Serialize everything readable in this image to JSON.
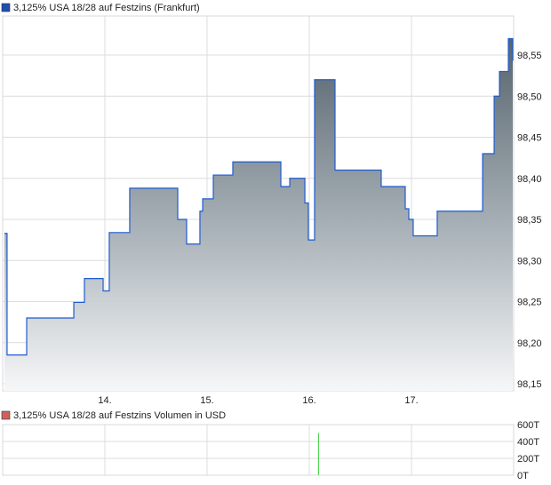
{
  "chart_data": [
    {
      "type": "area",
      "title": "3,125% USA 18/28 auf Festzins (Frankfurt)",
      "legend_color": "#1f4fb0",
      "line_color": "#1f5bd0",
      "x_ticks": [
        {
          "day": 14,
          "label": "14."
        },
        {
          "day": 15,
          "label": "15."
        },
        {
          "day": 16,
          "label": "16."
        },
        {
          "day": 17,
          "label": "17."
        }
      ],
      "xlim": [
        13.0,
        18.0
      ],
      "ylim": [
        98.13,
        98.597
      ],
      "y_ticks": [
        {
          "v": 98.15,
          "label": "98,15"
        },
        {
          "v": 98.2,
          "label": "98,20"
        },
        {
          "v": 98.25,
          "label": "98,25"
        },
        {
          "v": 98.3,
          "label": "98,30"
        },
        {
          "v": 98.35,
          "label": "98,35"
        },
        {
          "v": 98.4,
          "label": "98,40"
        },
        {
          "v": 98.45,
          "label": "98,45"
        },
        {
          "v": 98.5,
          "label": "98,50"
        },
        {
          "v": 98.55,
          "label": "98,55"
        }
      ],
      "points": [
        [
          13.017,
          98.333
        ],
        [
          13.043,
          98.185
        ],
        [
          13.235,
          98.23
        ],
        [
          13.696,
          98.249
        ],
        [
          13.8,
          98.278
        ],
        [
          13.983,
          98.263
        ],
        [
          14.043,
          98.334
        ],
        [
          14.243,
          98.388
        ],
        [
          14.713,
          98.35
        ],
        [
          14.8,
          98.32
        ],
        [
          14.93,
          98.36
        ],
        [
          14.957,
          98.375
        ],
        [
          15.061,
          98.404
        ],
        [
          15.252,
          98.42
        ],
        [
          15.722,
          98.39
        ],
        [
          15.809,
          98.4
        ],
        [
          15.939,
          98.4
        ],
        [
          15.957,
          98.37
        ],
        [
          15.991,
          98.325
        ],
        [
          16.052,
          98.52
        ],
        [
          16.252,
          98.41
        ],
        [
          16.704,
          98.39
        ],
        [
          16.939,
          98.363
        ],
        [
          16.974,
          98.35
        ],
        [
          17.017,
          98.33
        ],
        [
          17.07,
          98.33
        ],
        [
          17.252,
          98.36
        ],
        [
          17.696,
          98.43
        ],
        [
          17.809,
          98.5
        ],
        [
          17.861,
          98.53
        ],
        [
          17.948,
          98.57
        ],
        [
          17.991,
          98.543
        ]
      ]
    },
    {
      "type": "bar",
      "title": "3,125% USA 18/28 auf Festzins Volumen in USD",
      "legend_color": "#d06060",
      "bar_color": "#33cc33",
      "ylim": [
        0,
        600
      ],
      "y_ticks": [
        {
          "v": 0,
          "label": "0T"
        },
        {
          "v": 200,
          "label": "200T"
        },
        {
          "v": 400,
          "label": "400T"
        },
        {
          "v": 600,
          "label": "600T"
        }
      ],
      "bars": [
        [
          16.09,
          500
        ]
      ]
    }
  ]
}
